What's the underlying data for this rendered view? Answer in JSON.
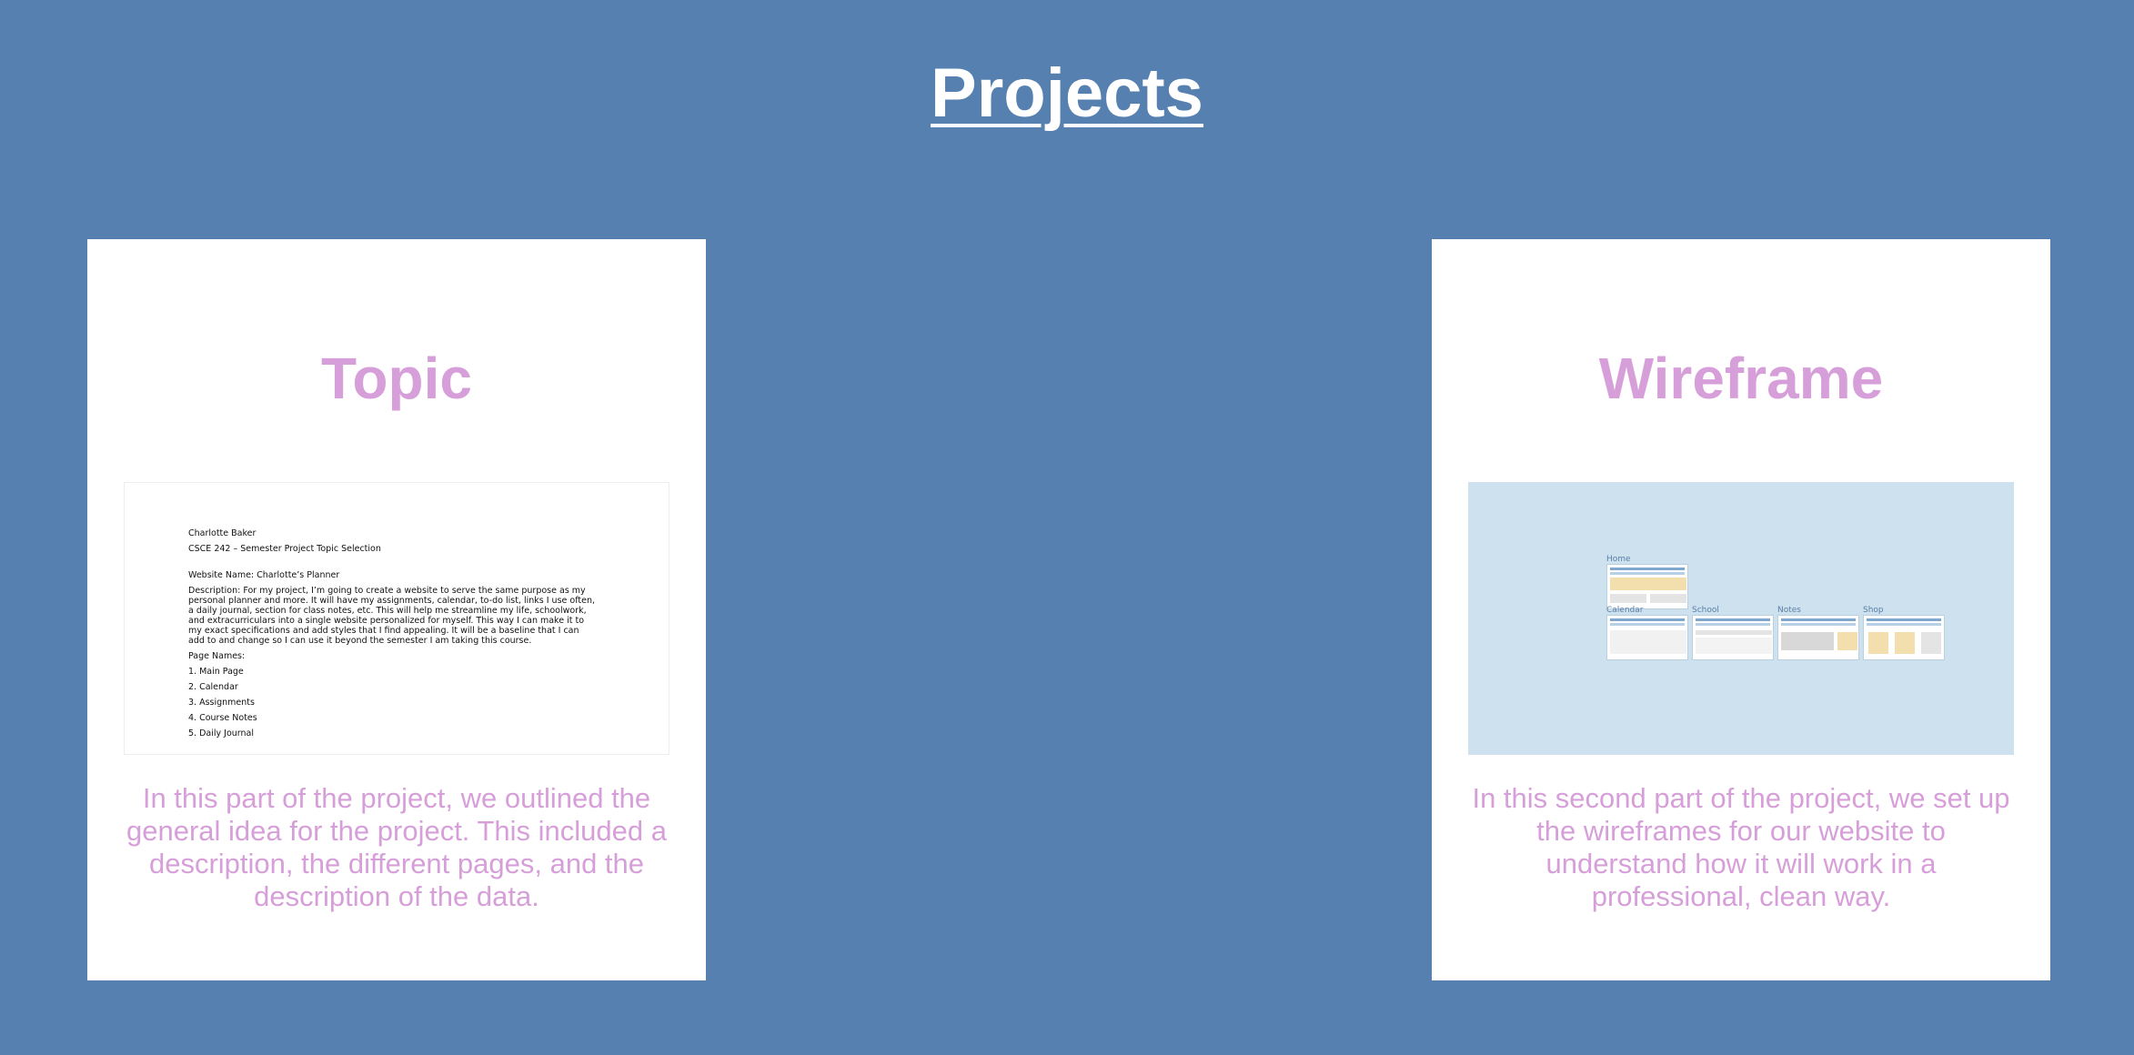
{
  "header": {
    "title": "Projects"
  },
  "cards": [
    {
      "title": "Topic",
      "preview": {
        "lines": [
          "Charlotte Baker",
          "CSCE 242 – Semester Project Topic Selection",
          "Website Name: Charlotte’s Planner",
          "Description: For my project, I’m going to create a website to serve the same purpose as my personal planner and more. It will have my assignments, calendar, to-do list, links I use often, a daily journal, section for class notes, etc. This will help me streamline my life, schoolwork, and extracurriculars into a single website personalized for myself. This way I can make it to my exact specifications and add styles that I find appealing. It will be a baseline that I can add to and change so I can use it beyond the semester I am taking this course.",
          "Page Names:",
          "1. Main Page",
          "2. Calendar",
          "3. Assignments",
          "4. Course Notes",
          "5. Daily Journal"
        ]
      },
      "description": "In this part of the project, we outlined the general idea for the project. This included a description, the different pages, and the description of the data."
    },
    {
      "title": "Wireframe",
      "preview": {
        "labels": [
          "Home",
          "Calendar",
          "School",
          "Notes",
          "Shop"
        ]
      },
      "description": "In this second part of the project, we set up the wireframes for our website to understand how it will work in a professional, clean way."
    }
  ]
}
